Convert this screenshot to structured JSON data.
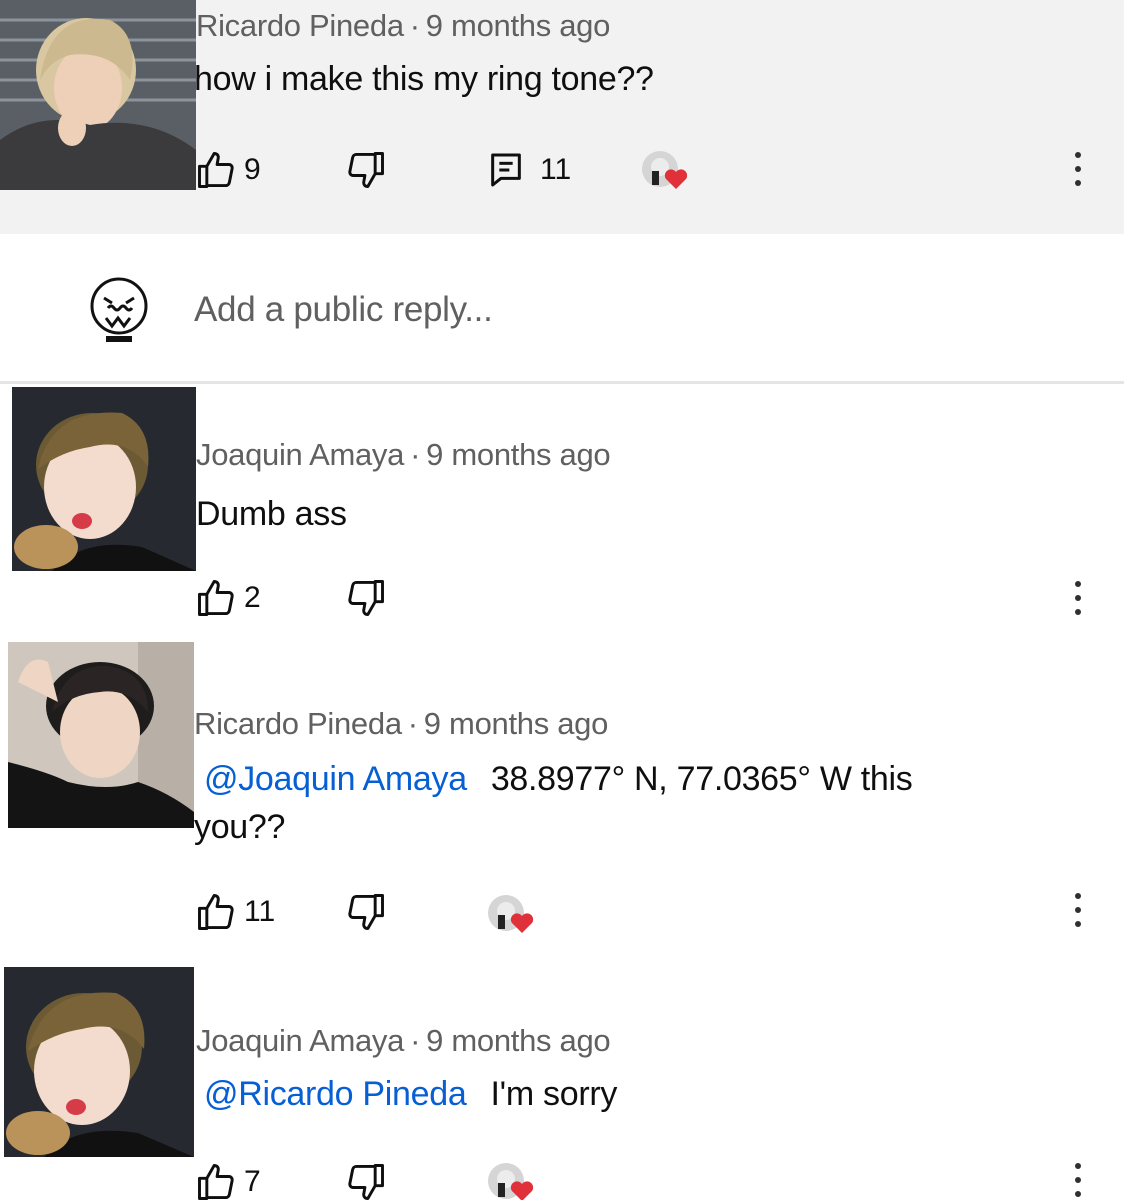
{
  "comments": [
    {
      "author": "Ricardo Pineda",
      "age": "9 months ago",
      "mention": "",
      "text": "how i make this my ring tone??",
      "likes": "9",
      "replies": "11",
      "creator_heart": true,
      "avatar_desc": "blond-hair-person-avatar"
    },
    {
      "author": "Joaquin Amaya",
      "age": "9 months ago",
      "mention": "",
      "text": "Dumb ass",
      "likes": "2",
      "creator_heart": false,
      "avatar_desc": "brown-hair-person-avatar"
    },
    {
      "author": "Ricardo Pineda",
      "age": "9 months ago",
      "mention": "@Joaquin Amaya",
      "text_line1": "38.8977° N, 77.0365° W this",
      "text_line2": "you??",
      "likes": "11",
      "creator_heart": true,
      "avatar_desc": "dark-hair-person-avatar"
    },
    {
      "author": "Joaquin Amaya",
      "age": "9 months ago",
      "mention": "@Ricardo Pineda",
      "text": "I'm sorry",
      "likes": "7",
      "creator_heart": true,
      "avatar_desc": "brown-hair-person-avatar"
    }
  ],
  "reply_box": {
    "placeholder": "Add a public reply..."
  },
  "separator": "·",
  "colors": {
    "highlight_bg": "#f2f2f2",
    "mention": "#065fd4",
    "meta": "#606060"
  }
}
